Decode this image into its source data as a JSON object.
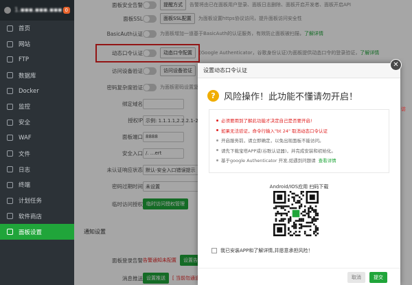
{
  "sidebar": {
    "host": "1.▪▪▪.▪▪▪.▪▪▪",
    "badge": "0",
    "items": [
      {
        "label": "首页",
        "icon": "home-icon"
      },
      {
        "label": "网站",
        "icon": "globe-icon"
      },
      {
        "label": "FTP",
        "icon": "ftp-icon"
      },
      {
        "label": "数据库",
        "icon": "database-icon"
      },
      {
        "label": "Docker",
        "icon": "docker-icon"
      },
      {
        "label": "监控",
        "icon": "monitor-icon"
      },
      {
        "label": "安全",
        "icon": "shield-icon"
      },
      {
        "label": "WAF",
        "icon": "waf-icon"
      },
      {
        "label": "文件",
        "icon": "folder-icon"
      },
      {
        "label": "日志",
        "icon": "log-icon"
      },
      {
        "label": "终端",
        "icon": "terminal-icon"
      },
      {
        "label": "计划任务",
        "icon": "clock-icon"
      },
      {
        "label": "软件商店",
        "icon": "store-icon"
      },
      {
        "label": "面板设置",
        "icon": "gear-icon"
      }
    ],
    "active_index": 13
  },
  "settings": {
    "rows": [
      {
        "label": "面板安全告警",
        "button": "提醒方式",
        "hint": "告警将由已在面板用户登录、面板日志删除、面板开启开发者、面板开启API"
      },
      {
        "label": "面板SSL",
        "button": "面板SSL配置",
        "hint": "为面板设置https协议访问，提升面板访问安全性"
      },
      {
        "label": "BasicAuth认证",
        "button": "",
        "hint": "为面板增加一道基于BasicAuth的认证服务，有效防止面板被扫描，",
        "link": "了解详情"
      },
      {
        "label": "动态口令认证",
        "button": "动态口令配置",
        "hint": "(Google Authenticator，谷歌身份认证)为面板提供动态口令的登录验证，",
        "link": "了解详情"
      },
      {
        "label": "访问设备验证",
        "button": "访问设备验证",
        "hint": ""
      },
      {
        "label": "密码复杂度验证",
        "button": "",
        "hint": "为面板密码设置复杂度验证"
      },
      {
        "label": "绑定域名",
        "input": ""
      },
      {
        "label": "授权IP",
        "input": "示例: 1.1.1.1,2.2.2.1-2.2"
      },
      {
        "label": "面板端口",
        "input": "8888"
      },
      {
        "label": "安全入口",
        "input": "/. ...ert"
      },
      {
        "label": "未认证响应状态",
        "input": "默认-安全入口错误提示"
      },
      {
        "label": "密码过期时间",
        "input": "未设置"
      },
      {
        "label": "临时访问授权",
        "button": "临时访问授权管理"
      }
    ],
    "notify_section": "通知设置",
    "notify_rows": [
      {
        "label": "面板登录告警",
        "link": "告警通知未配置",
        "button": "设置告"
      },
      {
        "label": "消息推送",
        "button": "设置推送",
        "link": "[ 当前勿通道"
      }
    ]
  },
  "dialog": {
    "title": "设置动态口令认证",
    "warning_title": "风险操作！此功能不懂请勿开启！",
    "bullets": [
      {
        "text": "必须要用到了解此功能才决定自己是否要开启!",
        "red": true
      },
      {
        "text": "如果无法验证，命令行输入\"bt 24\" 取消动态口令认证",
        "red": true
      },
      {
        "text": "开启服务前，请立即确定，以免出现面板不能访问。",
        "red": false
      },
      {
        "text": "请先下载宝塔APP或(谷歌认证器)，并完成安装和初始化。",
        "red": false
      },
      {
        "text": "基于google Authenticator 开发,如遇到问题请",
        "red": false,
        "link": "查看详情"
      }
    ],
    "qr_caption": "Android/IOS应用 扫码下载",
    "agree_label": "我已安装APP和了解详情,并愿意承担风险！",
    "cancel_label": "取消",
    "ok_label": "提交",
    "close_glyph": "✕"
  },
  "colors": {
    "accent": "#20a53a",
    "danger": "#e02020",
    "warn": "#f0ad00"
  }
}
